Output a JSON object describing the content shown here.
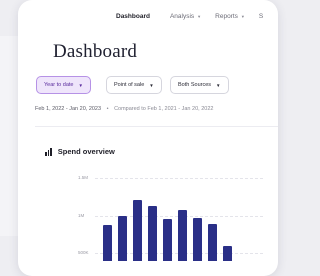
{
  "nav": {
    "items": [
      {
        "label": "Dashboard",
        "active": true,
        "dropdown": false
      },
      {
        "label": "Analysis",
        "active": false,
        "dropdown": true
      },
      {
        "label": "Reports",
        "active": false,
        "dropdown": true
      },
      {
        "label": "S",
        "active": false,
        "dropdown": false
      }
    ]
  },
  "page": {
    "title": "Dashboard"
  },
  "filters": {
    "period": "Year to date",
    "location": "Point of sale",
    "sources": "Both Sources"
  },
  "date_range": {
    "current": "Feb 1, 2022 - Jan 20, 2023",
    "separator": "•",
    "comparison": "Compared to Feb 1, 2021 - Jan 20, 2022"
  },
  "spend_overview": {
    "title": "Spend overview",
    "icon": "bar-chart-icon"
  },
  "chart_data": {
    "type": "bar",
    "title": "Spend overview",
    "y_ticks": [
      "1.5M",
      "1M",
      "500K"
    ],
    "ylim": [
      500000,
      1500000
    ],
    "values": [
      870000,
      990000,
      1210000,
      1130000,
      950000,
      1080000,
      970000,
      890000,
      600000
    ],
    "color": "#2a2f87"
  },
  "colors": {
    "accent_bg": "#efe5fb",
    "accent_border": "#b692e6",
    "accent_text": "#5b2d9e",
    "bar": "#2a2f87"
  }
}
